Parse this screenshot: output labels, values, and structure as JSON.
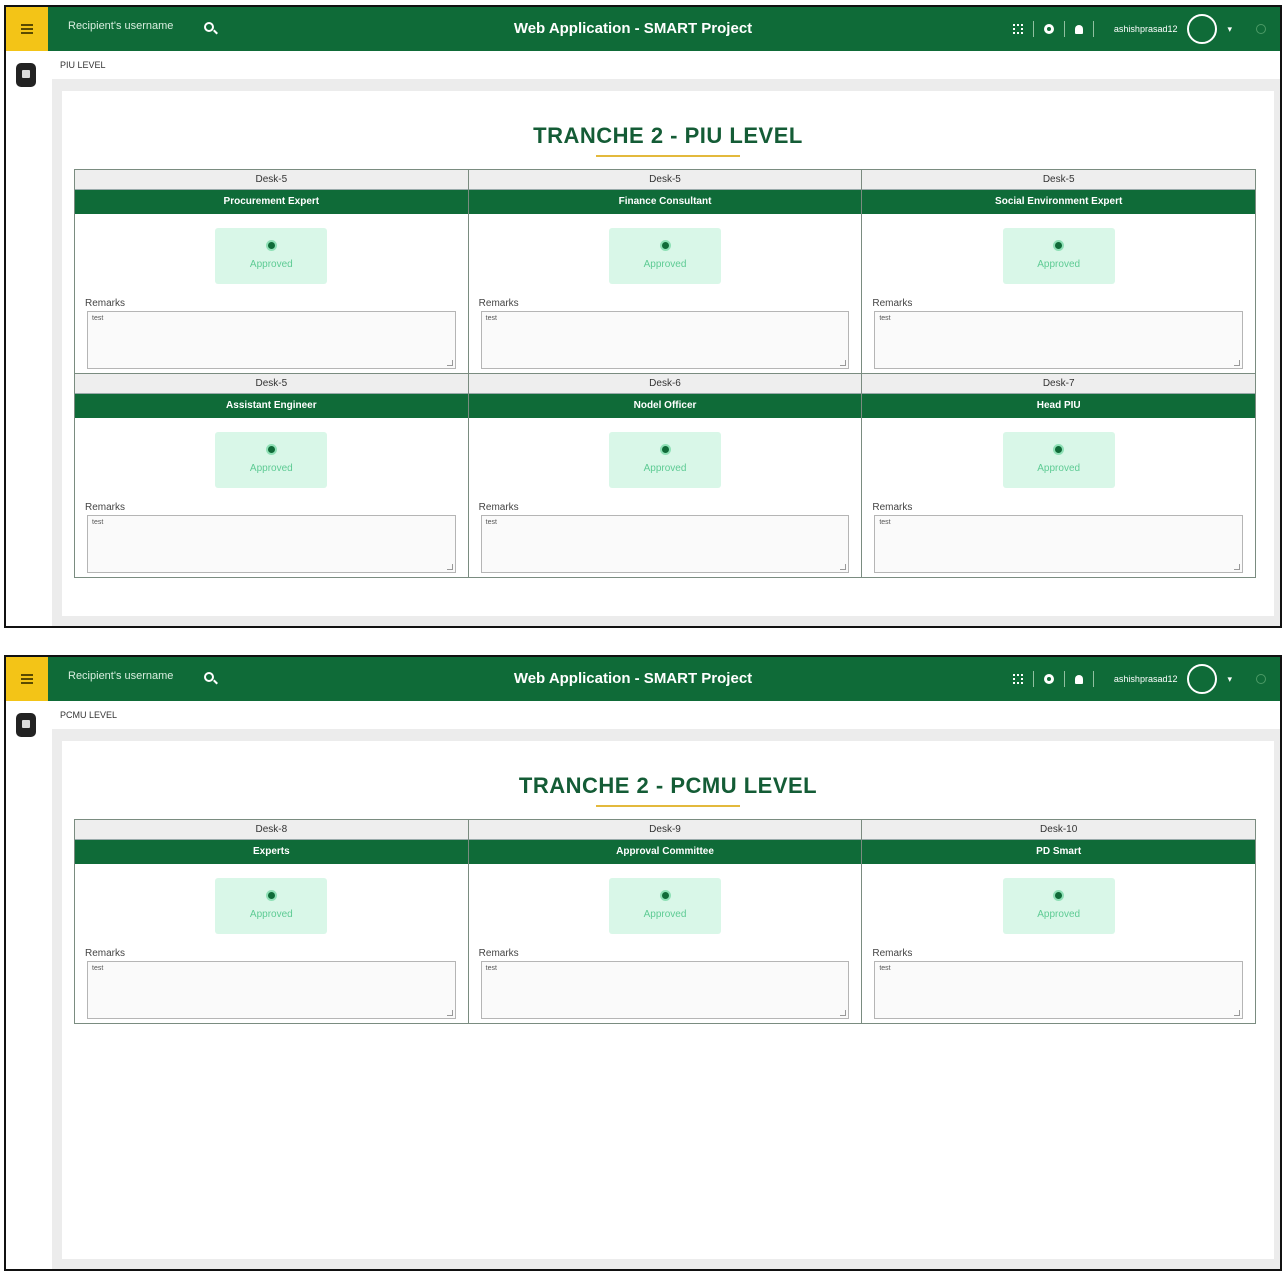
{
  "header": {
    "search_placeholder": "Recipient's username",
    "title": "Web Application - SMART Project",
    "username": "ashishprasad12",
    "icons": [
      "menu-icon",
      "search-icon",
      "fullscreen-icon",
      "gear-icon",
      "bell-icon",
      "avatar",
      "power-icon"
    ]
  },
  "colors": {
    "topbar": "#0f6b38",
    "menu_button": "#f3c417",
    "heading": "#145c36",
    "approved_bg": "#d9f7e8",
    "underline": "#e3b93c"
  },
  "screens": [
    {
      "breadcrumb": "PIU LEVEL",
      "heading": "TRANCHE 2 - PIU LEVEL",
      "rows": [
        [
          {
            "desk": "Desk-5",
            "role": "Procurement Expert",
            "status": "Approved",
            "remarks_label": "Remarks",
            "remarks": "test"
          },
          {
            "desk": "Desk-5",
            "role": "Finance Consultant",
            "status": "Approved",
            "remarks_label": "Remarks",
            "remarks": "test"
          },
          {
            "desk": "Desk-5",
            "role": "Social Environment Expert",
            "status": "Approved",
            "remarks_label": "Remarks",
            "remarks": "test"
          }
        ],
        [
          {
            "desk": "Desk-5",
            "role": "Assistant Engineer",
            "status": "Approved",
            "remarks_label": "Remarks",
            "remarks": "test"
          },
          {
            "desk": "Desk-6",
            "role": "Nodel Officer",
            "status": "Approved",
            "remarks_label": "Remarks",
            "remarks": "test"
          },
          {
            "desk": "Desk-7",
            "role": "Head PIU",
            "status": "Approved",
            "remarks_label": "Remarks",
            "remarks": "test"
          }
        ]
      ]
    },
    {
      "breadcrumb": "PCMU LEVEL",
      "heading": "TRANCHE 2 - PCMU LEVEL",
      "rows": [
        [
          {
            "desk": "Desk-8",
            "role": "Experts",
            "status": "Approved",
            "remarks_label": "Remarks",
            "remarks": "test"
          },
          {
            "desk": "Desk-9",
            "role": "Approval Committee",
            "status": "Approved",
            "remarks_label": "Remarks",
            "remarks": "test"
          },
          {
            "desk": "Desk-10",
            "role": "PD Smart",
            "status": "Approved",
            "remarks_label": "Remarks",
            "remarks": "test"
          }
        ]
      ]
    }
  ]
}
